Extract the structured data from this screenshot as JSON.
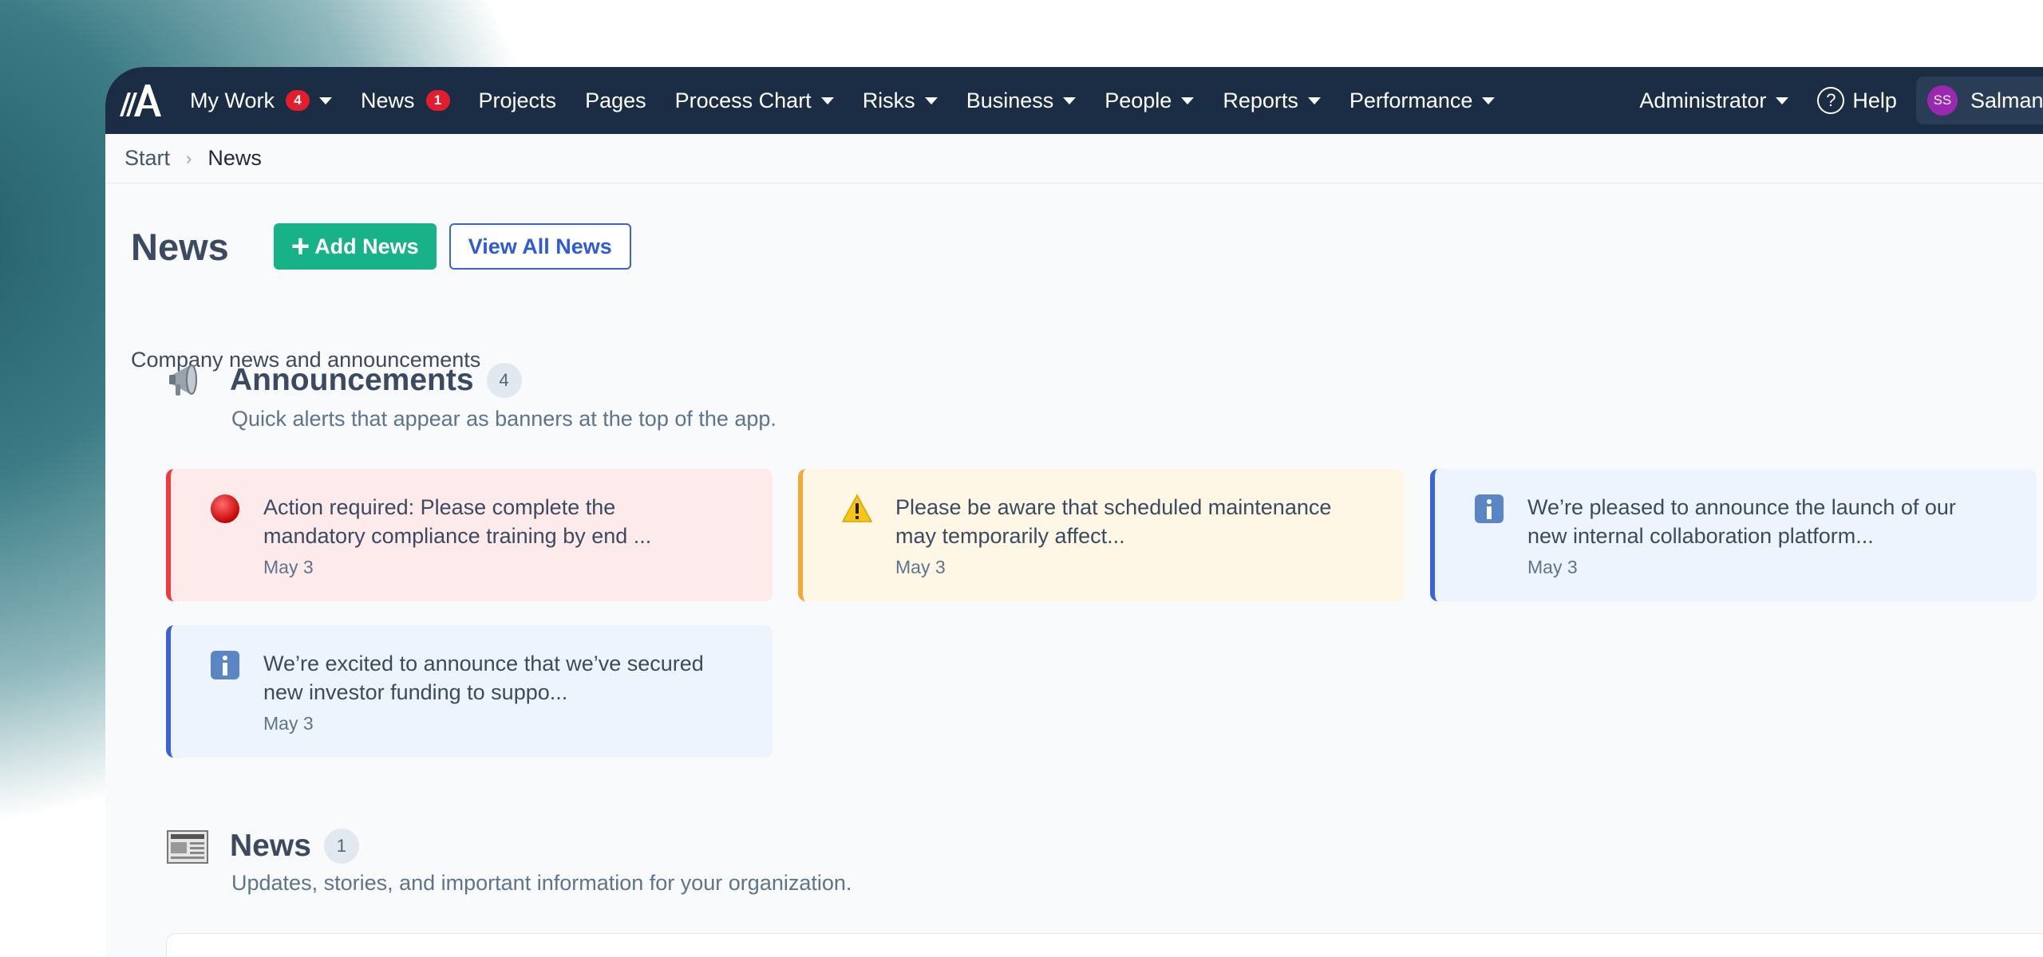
{
  "nav": {
    "items": [
      {
        "label": "My Work",
        "badge": "4",
        "caret": true
      },
      {
        "label": "News",
        "badge": "1",
        "caret": false
      },
      {
        "label": "Projects"
      },
      {
        "label": "Pages"
      },
      {
        "label": "Process Chart",
        "caret": true
      },
      {
        "label": "Risks",
        "caret": true
      },
      {
        "label": "Business",
        "caret": true
      },
      {
        "label": "People",
        "caret": true
      },
      {
        "label": "Reports",
        "caret": true
      },
      {
        "label": "Performance",
        "caret": true
      }
    ],
    "admin_label": "Administrator",
    "help_label": "Help",
    "help_icon_glyph": "?",
    "user_initials": "SS",
    "user_name": "Salman S"
  },
  "breadcrumb": {
    "start": "Start",
    "separator": "›",
    "current": "News"
  },
  "page": {
    "title": "News",
    "add_button": "Add News",
    "add_icon_glyph": "+",
    "view_all_button": "View All News",
    "subtitle": "Company news and announcements"
  },
  "announcements": {
    "title": "Announcements",
    "count": "4",
    "subtitle": "Quick alerts that appear as banners at the top of the app.",
    "items": [
      {
        "type": "critical",
        "icon": "red-circle-icon",
        "text": "Action required: Please complete the mandatory compliance training by end ...",
        "date": "May 3"
      },
      {
        "type": "warning",
        "icon": "warning-icon",
        "text": "Please be aware that scheduled maintenance may temporarily affect...",
        "date": "May 3"
      },
      {
        "type": "info",
        "icon": "info-icon",
        "text": "We’re pleased to announce the launch of our new internal collaboration platform...",
        "date": "May 3"
      },
      {
        "type": "info",
        "icon": "info-icon",
        "text": "We’re excited to announce that we’ve secured new investor funding to suppo...",
        "date": "May 3"
      }
    ]
  },
  "news": {
    "title": "News",
    "count": "1",
    "subtitle": "Updates, stories, and important information for your organization."
  },
  "colors": {
    "nav_bg": "#1b2d44",
    "accent_green": "#17b287",
    "accent_blue": "#3a63d6",
    "critical": "#ef3b3b",
    "warning": "#f2a93b"
  }
}
